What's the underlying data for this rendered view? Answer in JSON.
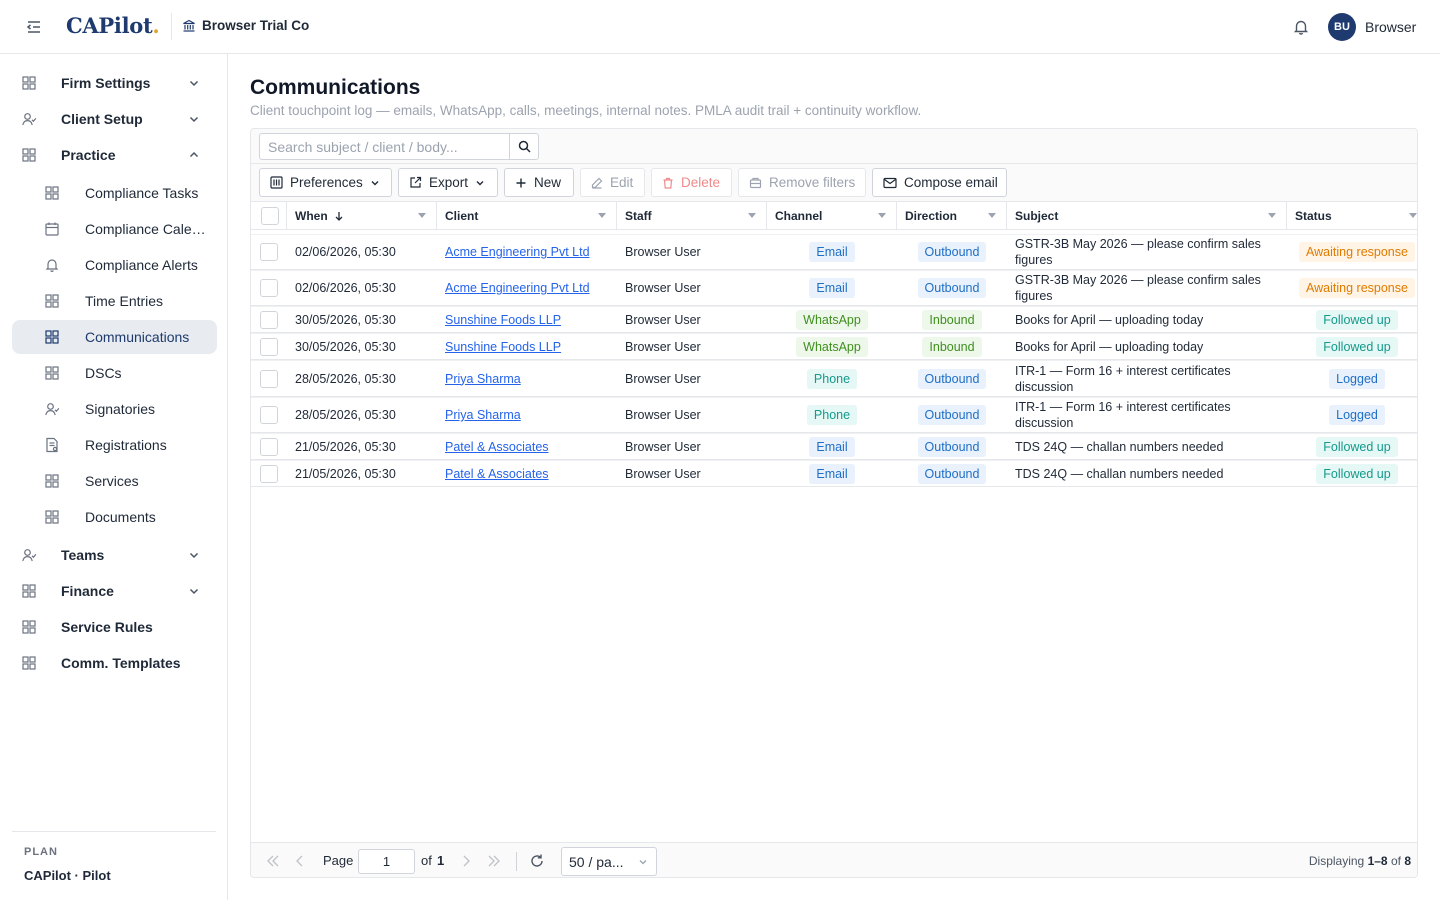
{
  "app": {
    "logo_text": "CAPilot",
    "logo_dot": ".",
    "firm_name": "Browser Trial Co",
    "user_initials": "BU",
    "user_name": "Browser"
  },
  "sidebar": {
    "items": [
      {
        "label": "Firm Settings",
        "icon": "grid-icon",
        "expandable": true,
        "expanded": false
      },
      {
        "label": "Client Setup",
        "icon": "users-icon",
        "expandable": true,
        "expanded": false
      },
      {
        "label": "Practice",
        "icon": "grid-icon",
        "expandable": true,
        "expanded": true
      },
      {
        "label": "Compliance Tasks",
        "icon": "grid-icon",
        "sub": true
      },
      {
        "label": "Compliance Calendar",
        "icon": "calendar-icon",
        "sub": true
      },
      {
        "label": "Compliance Alerts",
        "icon": "bell-icon",
        "sub": true
      },
      {
        "label": "Time Entries",
        "icon": "grid-icon",
        "sub": true
      },
      {
        "label": "Communications",
        "icon": "grid-icon",
        "sub": true,
        "active": true
      },
      {
        "label": "DSCs",
        "icon": "grid-icon",
        "sub": true
      },
      {
        "label": "Signatories",
        "icon": "users-icon",
        "sub": true
      },
      {
        "label": "Registrations",
        "icon": "register-icon",
        "sub": true
      },
      {
        "label": "Services",
        "icon": "grid-icon",
        "sub": true
      },
      {
        "label": "Documents",
        "icon": "grid-icon",
        "sub": true
      },
      {
        "label": "Teams",
        "icon": "users-icon",
        "expandable": true,
        "expanded": false
      },
      {
        "label": "Finance",
        "icon": "grid-icon",
        "expandable": true,
        "expanded": false
      },
      {
        "label": "Service Rules",
        "icon": "grid-icon"
      },
      {
        "label": "Comm. Templates",
        "icon": "grid-icon"
      }
    ],
    "plan_label": "PLAN",
    "plan_value": "CAPilot · Pilot"
  },
  "page": {
    "title": "Communications",
    "subtitle": "Client touchpoint log — emails, WhatsApp, calls, meetings, internal notes. PMLA audit trail + continuity workflow."
  },
  "search": {
    "placeholder": "Search subject / client / body...",
    "value": ""
  },
  "toolbar": {
    "preferences": "Preferences",
    "export": "Export",
    "new": "New",
    "edit": "Edit",
    "delete": "Delete",
    "remove_filters": "Remove filters",
    "compose": "Compose email"
  },
  "table": {
    "columns": [
      "When",
      "Client",
      "Staff",
      "Channel",
      "Direction",
      "Subject",
      "Status"
    ],
    "rows": [
      {
        "when": "02/06/2026, 05:30",
        "client": "Acme Engineering Pvt Ltd",
        "staff": "Browser User",
        "channel": "Email",
        "direction": "Outbound",
        "subject": "GSTR-3B May 2026 — please confirm sales figures",
        "status": "Awaiting response"
      },
      {
        "when": "02/06/2026, 05:30",
        "client": "Acme Engineering Pvt Ltd",
        "staff": "Browser User",
        "channel": "Email",
        "direction": "Outbound",
        "subject": "GSTR-3B May 2026 — please confirm sales figures",
        "status": "Awaiting response"
      },
      {
        "when": "30/05/2026, 05:30",
        "client": "Sunshine Foods LLP",
        "staff": "Browser User",
        "channel": "WhatsApp",
        "direction": "Inbound",
        "subject": "Books for April — uploading today",
        "status": "Followed up"
      },
      {
        "when": "30/05/2026, 05:30",
        "client": "Sunshine Foods LLP",
        "staff": "Browser User",
        "channel": "WhatsApp",
        "direction": "Inbound",
        "subject": "Books for April — uploading today",
        "status": "Followed up"
      },
      {
        "when": "28/05/2026, 05:30",
        "client": "Priya Sharma",
        "staff": "Browser User",
        "channel": "Phone",
        "direction": "Outbound",
        "subject": "ITR-1 — Form 16 + interest certificates discussion",
        "status": "Logged"
      },
      {
        "when": "28/05/2026, 05:30",
        "client": "Priya Sharma",
        "staff": "Browser User",
        "channel": "Phone",
        "direction": "Outbound",
        "subject": "ITR-1 — Form 16 + interest certificates discussion",
        "status": "Logged"
      },
      {
        "when": "21/05/2026, 05:30",
        "client": "Patel & Associates",
        "staff": "Browser User",
        "channel": "Email",
        "direction": "Outbound",
        "subject": "TDS 24Q — challan numbers needed",
        "status": "Followed up"
      },
      {
        "when": "21/05/2026, 05:30",
        "client": "Patel & Associates",
        "staff": "Browser User",
        "channel": "Email",
        "direction": "Outbound",
        "subject": "TDS 24Q — challan numbers needed",
        "status": "Followed up"
      }
    ]
  },
  "footer": {
    "page_label": "Page",
    "page_value": "1",
    "of_label": "of",
    "total_pages": "1",
    "page_size": "50 / pa...",
    "displaying_prefix": "Displaying",
    "displaying_range": "1–8",
    "displaying_of": "of",
    "displaying_total": "8"
  },
  "colors": {
    "brand": "#1e3a6e",
    "accent_dot": "#e0a52b",
    "link": "#2563eb"
  }
}
